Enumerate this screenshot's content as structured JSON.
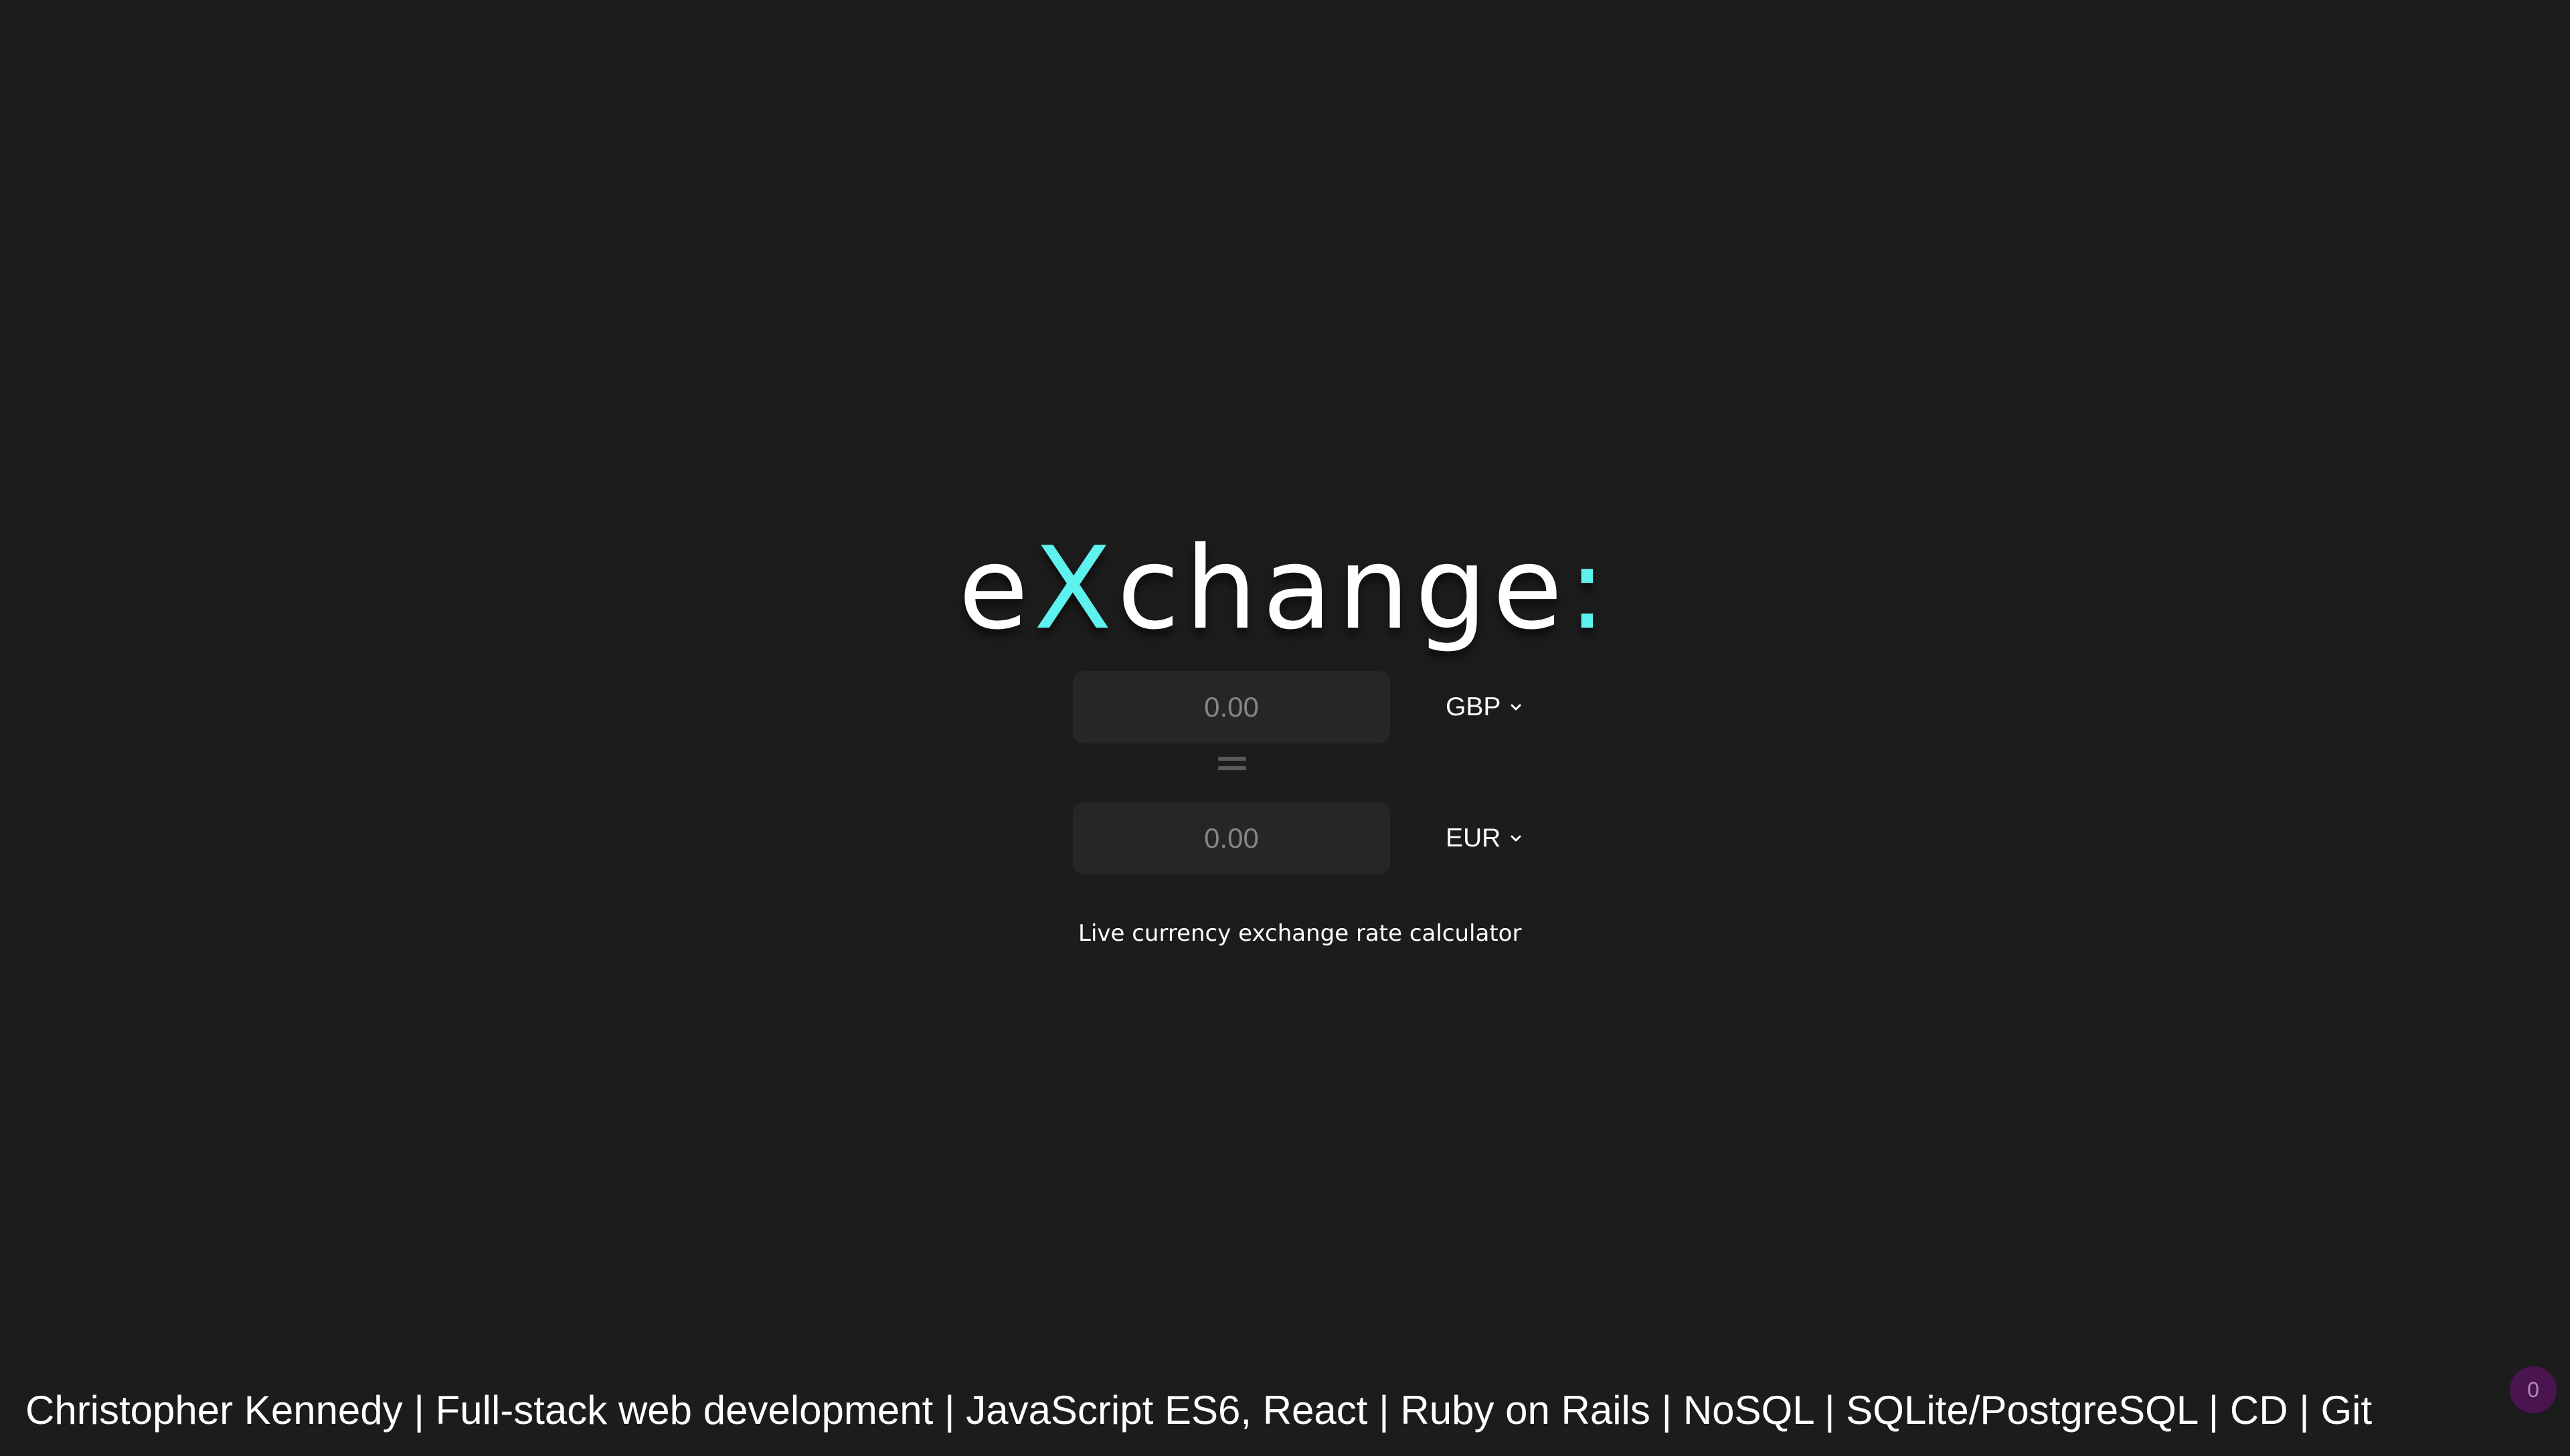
{
  "logo": {
    "part1": "e",
    "accent_letter": "X",
    "part2": "change",
    "accent_colon": ":"
  },
  "converter": {
    "from": {
      "placeholder": "0.00",
      "currency": "GBP",
      "chevron_icon": "chevron-down-icon"
    },
    "equals_icon": "equals-icon",
    "to": {
      "placeholder": "0.00",
      "currency": "EUR",
      "chevron_icon": "chevron-down-icon"
    }
  },
  "tagline": "Live currency exchange rate calculator",
  "footer": {
    "text": "Christopher Kennedy | Full-stack web development | JavaScript ES6, React | Ruby on Rails | NoSQL | SQLite/PostgreSQL | CD | Git"
  },
  "badge": {
    "count": "0"
  },
  "colors": {
    "background": "#1c1c1c",
    "accent": "#5ef2ee",
    "input_bg": "#262626",
    "badge_bg": "#4a1450"
  }
}
